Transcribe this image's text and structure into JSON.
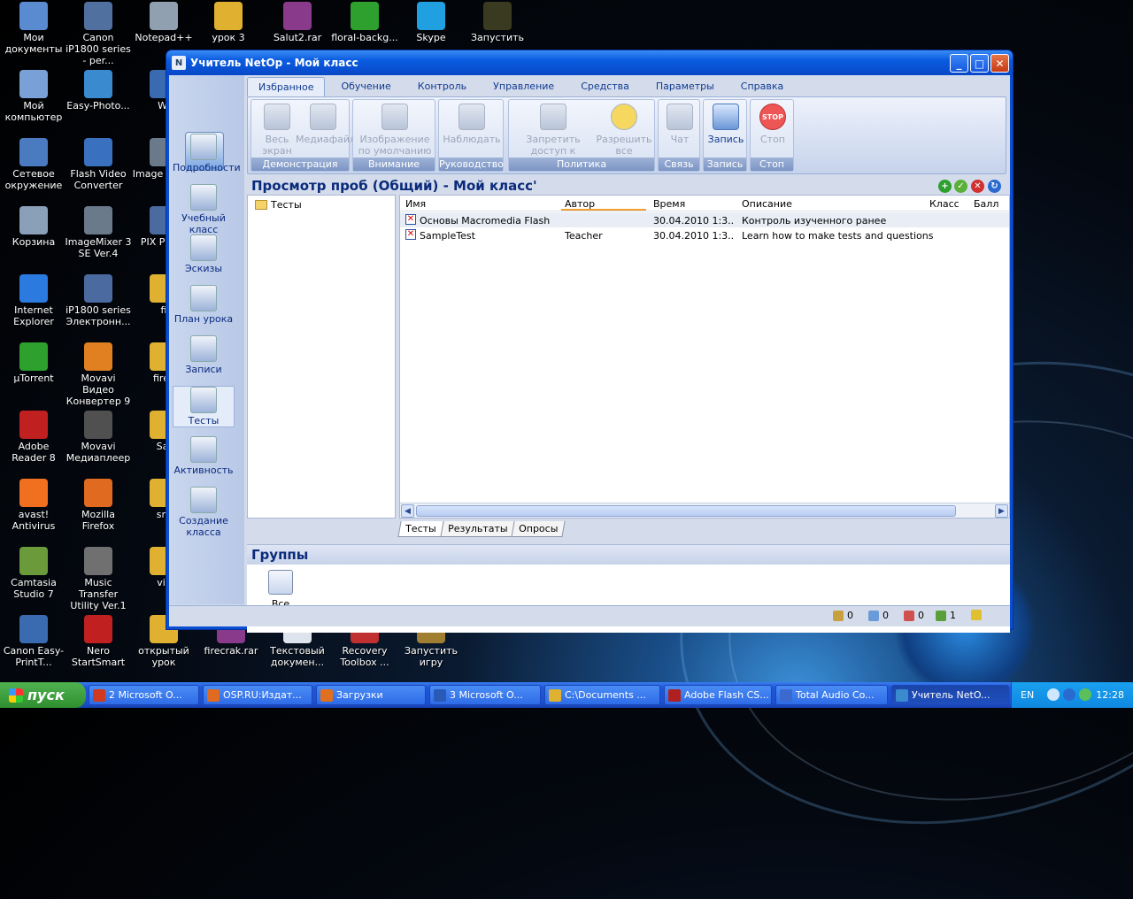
{
  "desktop_icons": [
    {
      "label": "Мои документы",
      "color": "#5a8ad0"
    },
    {
      "label": "Мой компьютер",
      "color": "#7aa0d8"
    },
    {
      "label": "Сетевое окружение",
      "color": "#4a7ac0"
    },
    {
      "label": "Корзина",
      "color": "#8aa0b8"
    },
    {
      "label": "Internet Explorer",
      "color": "#2a7ae0"
    },
    {
      "label": "µTorrent",
      "color": "#2ea02e"
    },
    {
      "label": "Adobe Reader 8",
      "color": "#c02020"
    },
    {
      "label": "avast! Antivirus",
      "color": "#f07020"
    },
    {
      "label": "Camtasia Studio 7",
      "color": "#6a9a3a"
    },
    {
      "label": "Canon Easy-PrintT...",
      "color": "#3a6ab0"
    },
    {
      "label": "Canon iP1800 series - per...",
      "color": "#5070a0"
    },
    {
      "label": "Easy-Photo...",
      "color": "#3a8ad0"
    },
    {
      "label": "Flash Video Converter",
      "color": "#3a70c0"
    },
    {
      "label": "ImageMixer 3 SE Ver.4",
      "color": "#6a7a8a"
    },
    {
      "label": "iP1800 series Электронн...",
      "color": "#4a6aa0"
    },
    {
      "label": "Movavi Видео Конвертер 9",
      "color": "#e08020"
    },
    {
      "label": "Movavi Медиаплеер",
      "color": "#505050"
    },
    {
      "label": "Mozilla Firefox",
      "color": "#e06a20"
    },
    {
      "label": "Music Transfer Utility Ver.1",
      "color": "#707070"
    },
    {
      "label": "Nero StartSmart",
      "color": "#c02020"
    },
    {
      "label": "Notepad++",
      "color": "#90a0b0"
    },
    {
      "label": "урок 3",
      "color": "#e0b030"
    },
    {
      "label": "Salut2.rar",
      "color": "#8a3a8a"
    },
    {
      "label": "floral-backg...",
      "color": "#2ea02e"
    },
    {
      "label": "Skype",
      "color": "#20a0e0"
    },
    {
      "label": "Запустить",
      "color": "#3a3a20"
    },
    {
      "label": "открытый урок",
      "color": "#e0b030"
    },
    {
      "label": "firecrak.rar",
      "color": "#8a3a8a"
    },
    {
      "label": "Текстовый докумен...",
      "color": "#dde4ee"
    },
    {
      "label": "Recovery Toolbox ...",
      "color": "#c03030"
    },
    {
      "label": "Запустить игру",
      "color": "#a08030"
    },
    {
      "label": "Wi",
      "color": "#3a6ab0"
    },
    {
      "label": "Image Home",
      "color": "#6a7a8a"
    },
    {
      "label": "PIX Produ",
      "color": "#4a6aa0"
    },
    {
      "label": "fi",
      "color": "#e0b030"
    },
    {
      "label": "firec",
      "color": "#e0b030"
    },
    {
      "label": "Sal",
      "color": "#e0b030"
    },
    {
      "label": "sm",
      "color": "#e0b030"
    },
    {
      "label": "vic",
      "color": "#e0b030"
    }
  ],
  "window": {
    "title": "Учитель NetOp - Мой класс",
    "tabs": [
      "Избранное",
      "Обучение",
      "Контроль",
      "Управление",
      "Средства",
      "Параметры",
      "Справка"
    ],
    "ribbon": {
      "groups": [
        {
          "label": "Демонстрация",
          "buttons": [
            "Весь экран",
            "Медиафайл"
          ]
        },
        {
          "label": "Внимание",
          "buttons": [
            "Изображение по умолчанию"
          ]
        },
        {
          "label": "Руководство",
          "buttons": [
            "Наблюдать"
          ]
        },
        {
          "label": "Политика",
          "buttons": [
            "Запретить доступ к Интернету",
            "Разрешить все"
          ]
        },
        {
          "label": "Связь",
          "buttons": [
            "Чат"
          ]
        },
        {
          "label": "Запись",
          "buttons": [
            "Запись"
          ]
        },
        {
          "label": "Стоп",
          "buttons": [
            "Стоп"
          ]
        }
      ]
    },
    "nav": [
      "Подробности",
      "Учебный класс",
      "Эскизы",
      "План урока",
      "Записи",
      "Тесты",
      "Активность",
      "Создание класса"
    ],
    "panel_title": "Просмотр проб (Общий)  - Мой класс'",
    "tree_root": "Тесты",
    "columns": [
      "Имя",
      "Автор",
      "Время",
      "Описание",
      "Класс",
      "Балл"
    ],
    "rows": [
      {
        "name": "Основы Macromedia Flash",
        "author": "",
        "time": "30.04.2010 1:3...",
        "desc": "Контроль изученного ранее"
      },
      {
        "name": "SampleTest",
        "author": "Teacher",
        "time": "30.04.2010 1:3...",
        "desc": "Learn how to make tests and questions"
      }
    ],
    "bottom_tabs": [
      "Тесты",
      "Результаты",
      "Опросы"
    ],
    "groups_title": "Группы",
    "group_all": "Все",
    "status": [
      "0",
      "0",
      "0",
      "1"
    ]
  },
  "taskbar": {
    "start": "пуск",
    "items": [
      "2 Microsoft O...",
      "OSP.RU:Издат...",
      "Загрузки",
      "3 Microsoft O...",
      "C:\\Documents ...",
      "Adobe Flash CS...",
      "Total Audio Co...",
      "Учитель NetO..."
    ],
    "lang": "EN",
    "time": "12:28"
  }
}
